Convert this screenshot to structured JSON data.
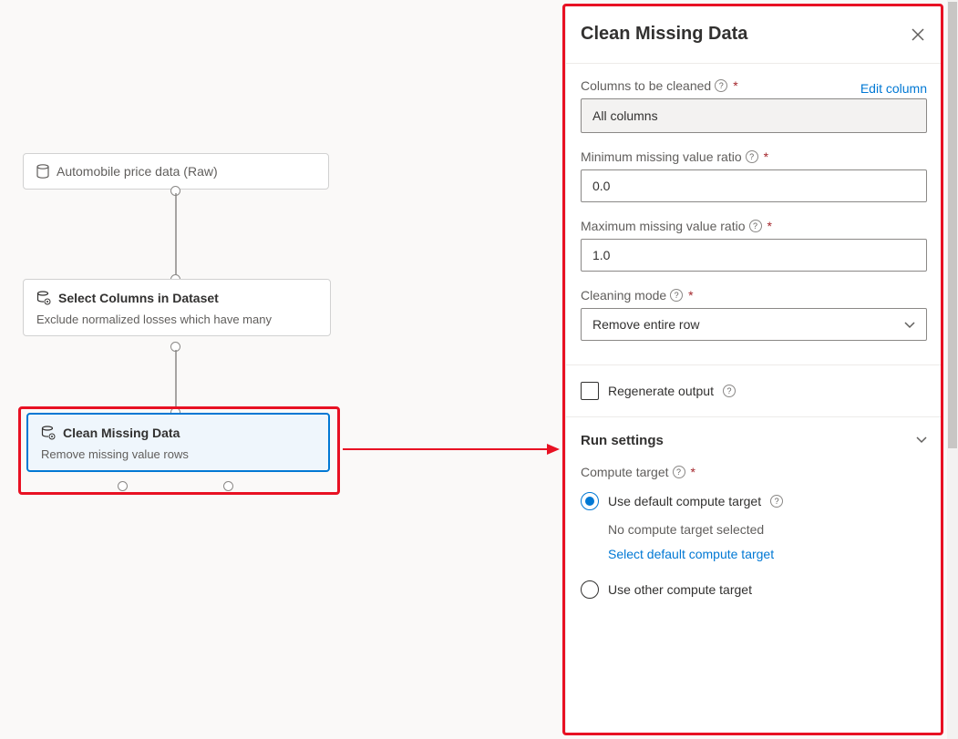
{
  "canvas": {
    "node_data": {
      "title": "Automobile price data (Raw)"
    },
    "node_select": {
      "title": "Select Columns in Dataset",
      "sub": "Exclude normalized losses which have many"
    },
    "node_clean": {
      "title": "Clean Missing Data",
      "sub": "Remove missing value rows"
    }
  },
  "panel": {
    "title": "Clean Missing Data",
    "fields": {
      "columns_label": "Columns to be cleaned",
      "columns_value": "All columns",
      "edit_link": "Edit column",
      "min_label": "Minimum missing value ratio",
      "min_value": "0.0",
      "max_label": "Maximum missing value ratio",
      "max_value": "1.0",
      "mode_label": "Cleaning mode",
      "mode_value": "Remove entire row",
      "regen_label": "Regenerate output"
    },
    "run": {
      "title": "Run settings",
      "target_label": "Compute target",
      "opt_default": "Use default compute target",
      "no_target": "No compute target selected",
      "select_link": "Select default compute target",
      "opt_other": "Use other compute target"
    }
  }
}
